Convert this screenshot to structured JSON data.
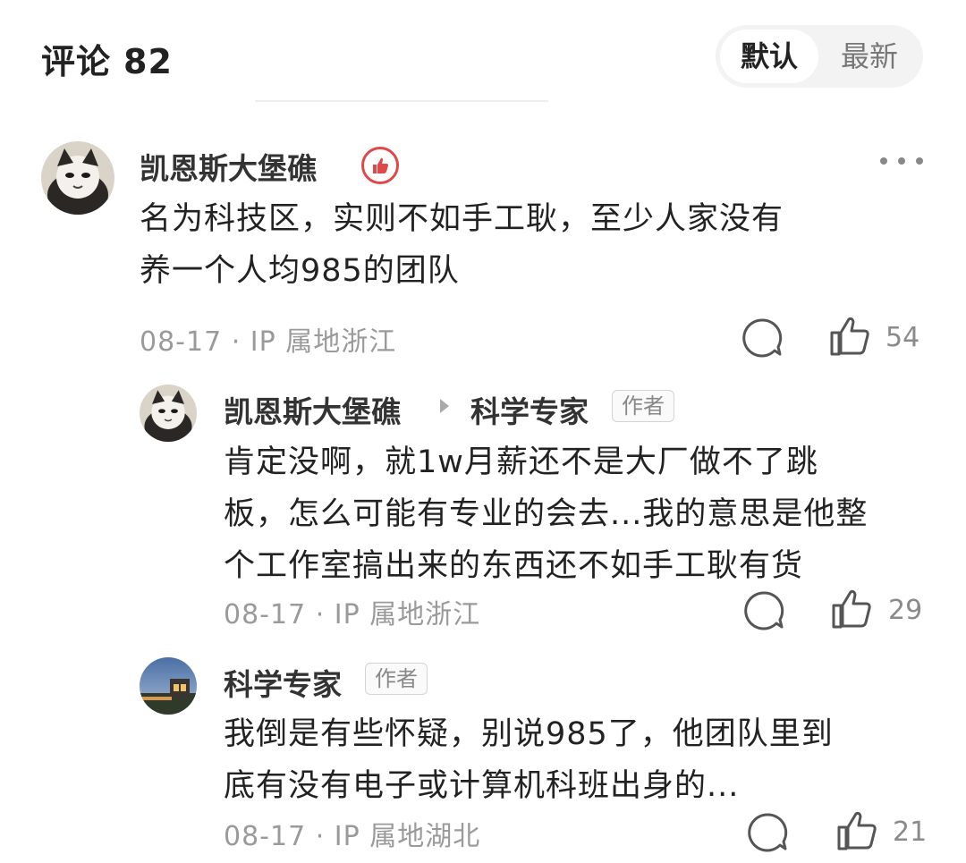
{
  "header": {
    "title": "评论",
    "count": "82",
    "sort_options": [
      "默认",
      "最新"
    ],
    "active_sort": "默认"
  },
  "comments": [
    {
      "username": "凯恩斯大堡礁",
      "lines": [
        "名为科技区，实则不如手工耿，至少人家没有",
        "养一个人均985的团队"
      ],
      "meta": "08-17 · IP 属地浙江",
      "likes": "54",
      "badge_icon": "thumbs-up-badge-icon"
    },
    {
      "username": "凯恩斯大堡礁",
      "reply_to": "科学专家",
      "reply_to_tag": "作者",
      "lines": [
        "肯定没啊，就1w月薪还不是大厂做不了跳",
        "板，怎么可能有专业的会去...我的意思是他整",
        "个工作室搞出来的东西还不如手工耿有货"
      ],
      "meta": "08-17 · IP 属地浙江",
      "likes": "29"
    },
    {
      "username": "科学专家",
      "tag": "作者",
      "lines": [
        "我倒是有些怀疑，别说985了，他团队里到",
        "底有没有电子或计算机科班出身的..."
      ],
      "meta": "08-17 · IP 属地湖北",
      "likes": "21"
    }
  ],
  "colors": {
    "badge_red": "#e0484a",
    "meta_gray": "#9a9a9a",
    "text_dark": "#222222"
  }
}
